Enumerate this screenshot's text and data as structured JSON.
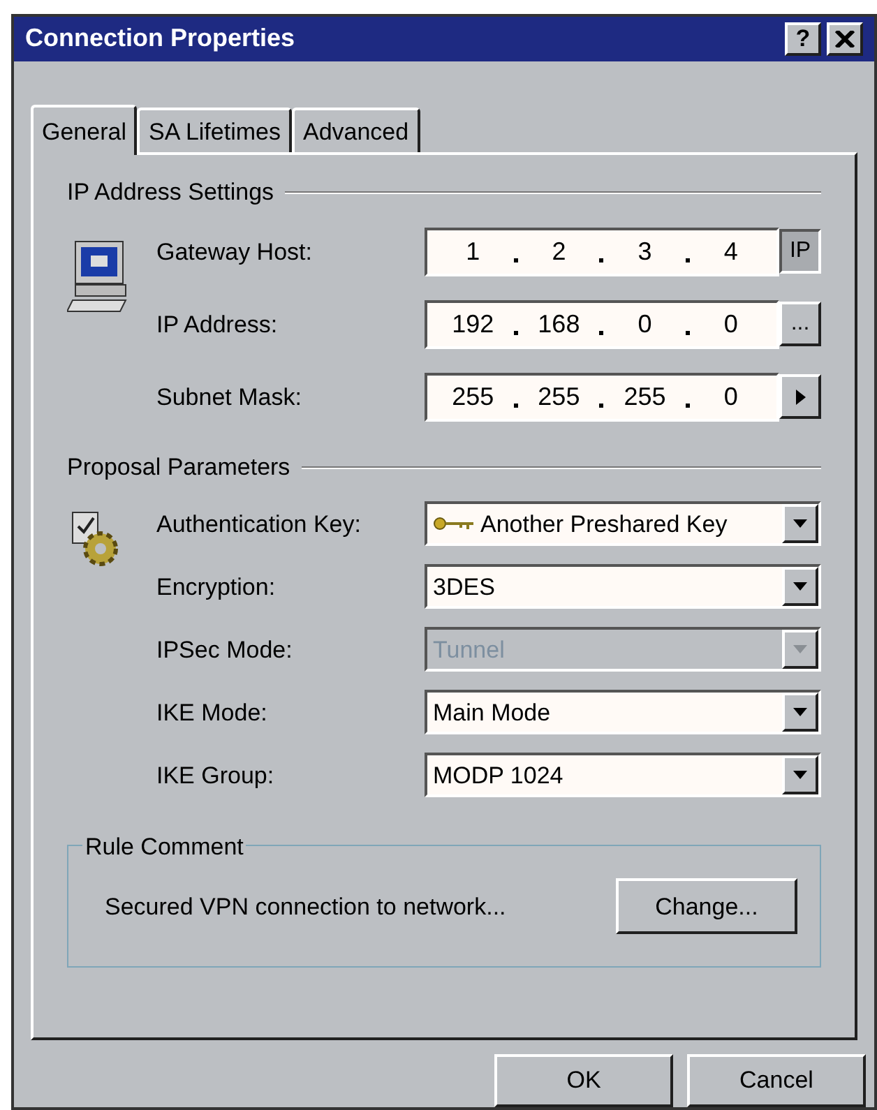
{
  "window": {
    "title": "Connection Properties",
    "help_button": "?"
  },
  "tabs": [
    {
      "label": "General",
      "selected": true
    },
    {
      "label": "SA Lifetimes",
      "selected": false
    },
    {
      "label": "Advanced",
      "selected": false
    }
  ],
  "ip_settings": {
    "heading": "IP Address Settings",
    "rows": [
      {
        "label": "Gateway Host:",
        "octets": [
          "1",
          "2",
          "3",
          "4"
        ],
        "side": {
          "kind": "text",
          "label": "IP",
          "pressed": true
        }
      },
      {
        "label": "IP Address:",
        "octets": [
          "192",
          "168",
          "0",
          "0"
        ],
        "side": {
          "kind": "text",
          "label": "...",
          "pressed": false
        }
      },
      {
        "label": "Subnet Mask:",
        "octets": [
          "255",
          "255",
          "255",
          "0"
        ],
        "side": {
          "kind": "arrow",
          "pressed": false
        }
      }
    ]
  },
  "proposal": {
    "heading": "Proposal Parameters",
    "rows": [
      {
        "label": "Authentication Key:",
        "value": "Another Preshared Key",
        "kind": "key",
        "disabled": false
      },
      {
        "label": "Encryption:",
        "value": "3DES",
        "kind": "plain",
        "disabled": false
      },
      {
        "label": "IPSec Mode:",
        "value": "Tunnel",
        "kind": "plain",
        "disabled": true
      },
      {
        "label": "IKE Mode:",
        "value": "Main Mode",
        "kind": "plain",
        "disabled": false
      },
      {
        "label": "IKE Group:",
        "value": "MODP 1024",
        "kind": "plain",
        "disabled": false
      }
    ]
  },
  "rule_comment": {
    "heading": "Rule Comment",
    "text": "Secured VPN connection to network...",
    "button": "Change..."
  },
  "buttons": [
    "OK",
    "Cancel"
  ]
}
